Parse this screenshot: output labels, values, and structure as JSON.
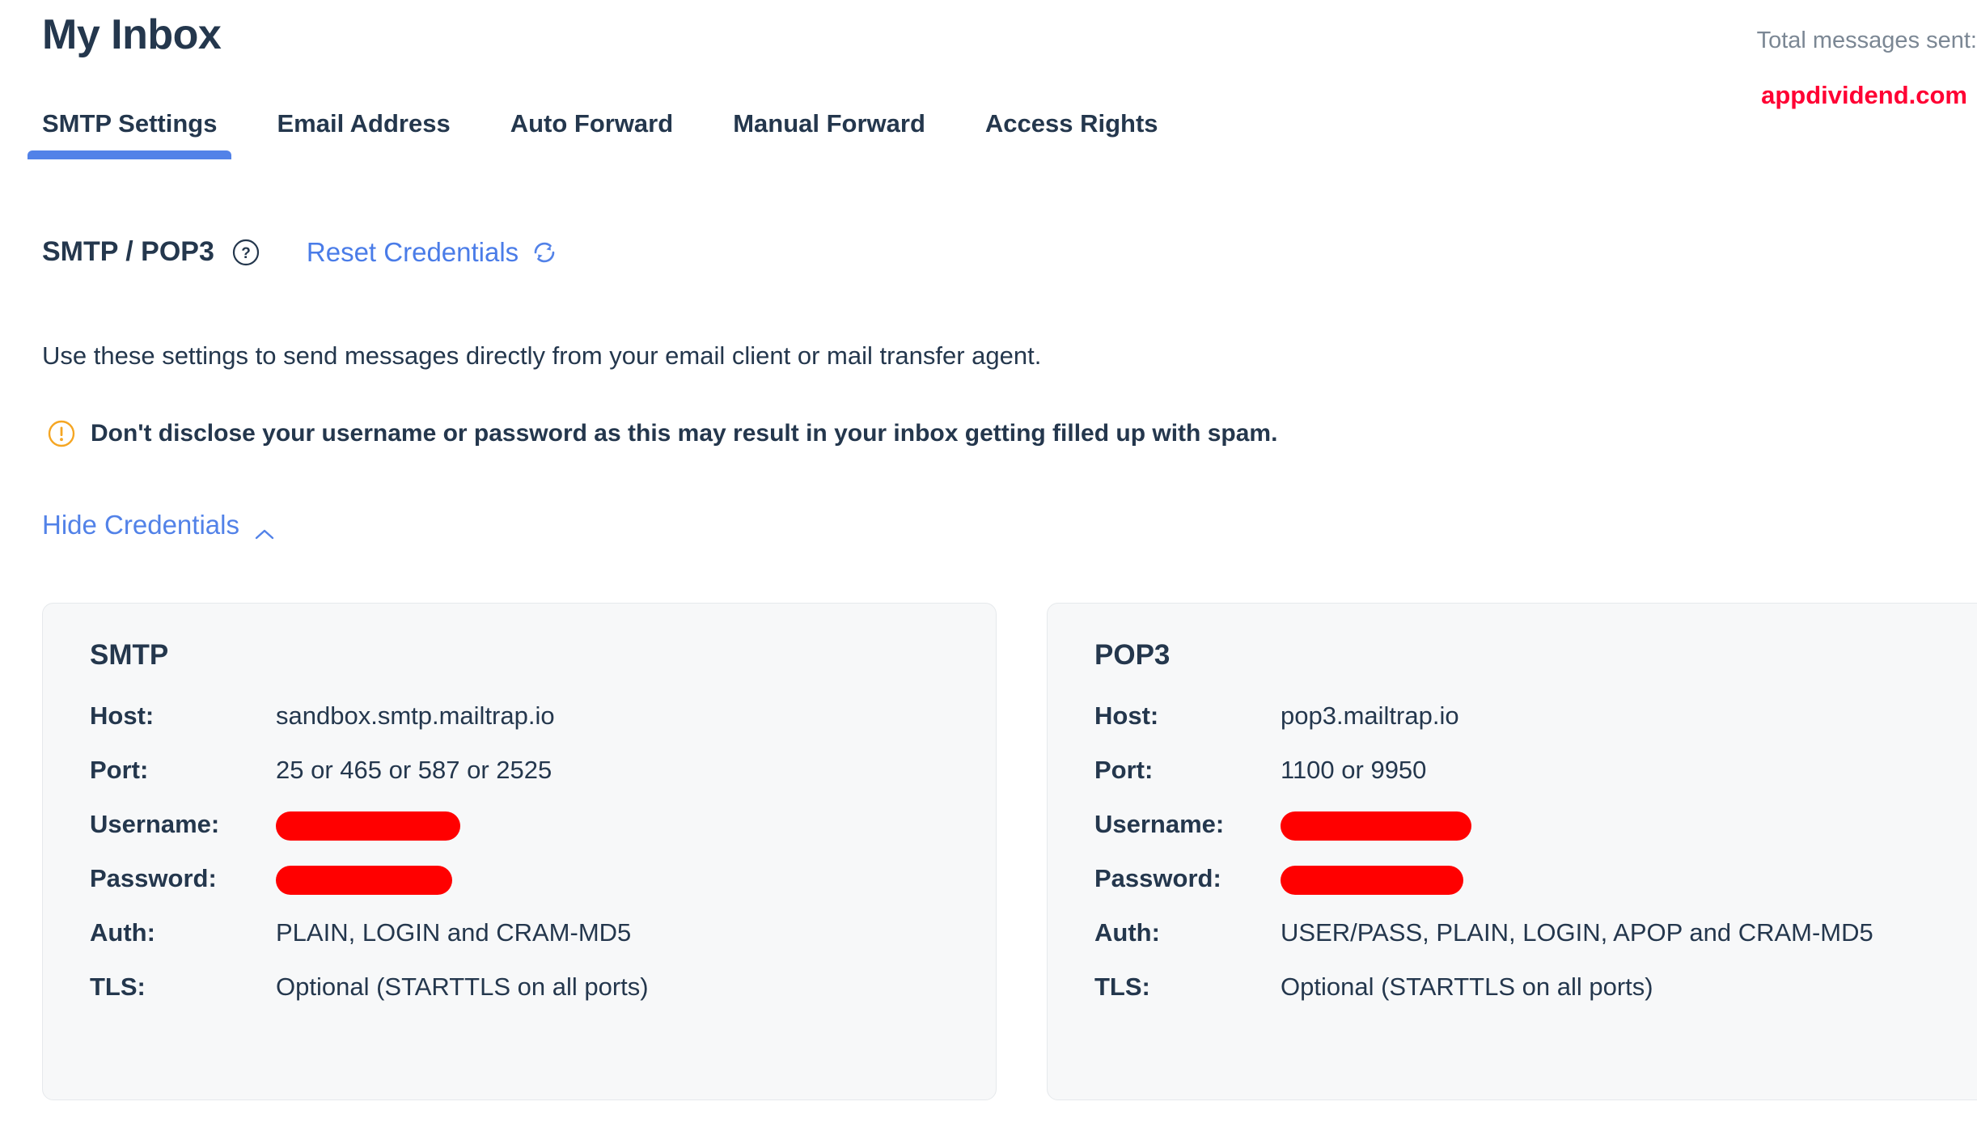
{
  "header": {
    "title": "My Inbox",
    "total_messages_label": "Total messages sent:",
    "watermark": "appdividend.com"
  },
  "tabs": [
    {
      "label": "SMTP Settings",
      "active": true
    },
    {
      "label": "Email Address",
      "active": false
    },
    {
      "label": "Auto Forward",
      "active": false
    },
    {
      "label": "Manual Forward",
      "active": false
    },
    {
      "label": "Access Rights",
      "active": false
    }
  ],
  "section": {
    "title": "SMTP / POP3",
    "help_icon": "question-mark-circle-icon",
    "reset_label": "Reset Credentials",
    "reset_icon": "refresh-icon",
    "description": "Use these settings to send messages directly from your email client or mail transfer agent.",
    "warning_icon": "exclamation-circle-icon",
    "warning_text": "Don't disclose your username or password as this may result in your inbox getting filled up with spam.",
    "toggle_credentials_label": "Hide Credentials",
    "toggle_chevron_icon": "chevron-up-icon"
  },
  "cards": {
    "smtp": {
      "title": "SMTP",
      "rows": [
        {
          "label": "Host:",
          "value": "sandbox.smtp.mailtrap.io",
          "redacted": false
        },
        {
          "label": "Port:",
          "value": "25 or 465 or 587 or 2525",
          "redacted": false
        },
        {
          "label": "Username:",
          "value": "",
          "redacted": true
        },
        {
          "label": "Password:",
          "value": "",
          "redacted": true
        },
        {
          "label": "Auth:",
          "value": "PLAIN, LOGIN and CRAM-MD5",
          "redacted": false
        },
        {
          "label": "TLS:",
          "value": "Optional (STARTTLS on all ports)",
          "redacted": false
        }
      ]
    },
    "pop3": {
      "title": "POP3",
      "rows": [
        {
          "label": "Host:",
          "value": "pop3.mailtrap.io",
          "redacted": false
        },
        {
          "label": "Port:",
          "value": "1100 or 9950",
          "redacted": false
        },
        {
          "label": "Username:",
          "value": "",
          "redacted": true
        },
        {
          "label": "Password:",
          "value": "",
          "redacted": true
        },
        {
          "label": "Auth:",
          "value": "USER/PASS, PLAIN, LOGIN, APOP and CRAM-MD5",
          "redacted": false
        },
        {
          "label": "TLS:",
          "value": "Optional (STARTTLS on all ports)",
          "redacted": false
        }
      ]
    }
  },
  "colors": {
    "accent_blue": "#5282e8",
    "link_blue": "#4a7ce8",
    "text_navy": "#24374d",
    "muted_gray": "#7b8794",
    "warning_orange": "#f5a623",
    "redaction_red": "#ff0000",
    "card_bg": "#f7f8f9",
    "watermark_red": "#ff0033"
  }
}
